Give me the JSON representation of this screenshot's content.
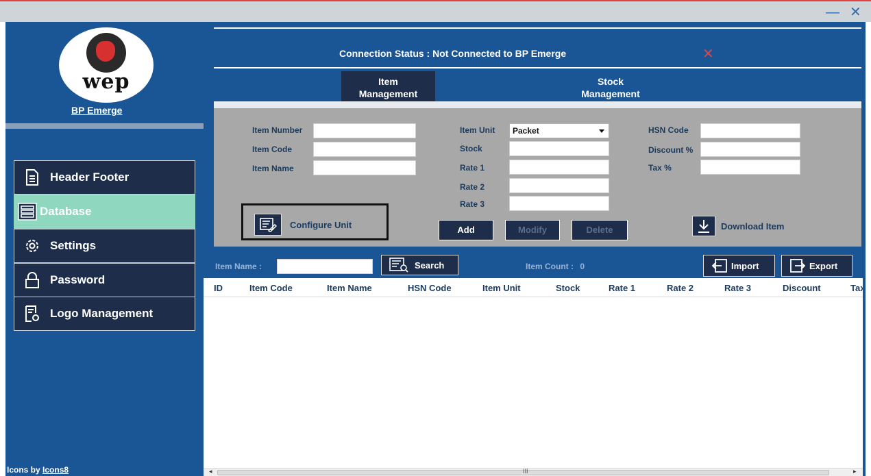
{
  "window": {
    "minimize_glyph": "—",
    "close_glyph": "✕"
  },
  "sidebar": {
    "logo_text": "wep",
    "app_name": "BP Emerge",
    "items": [
      {
        "label": "Header Footer",
        "icon": "document-icon",
        "active": false
      },
      {
        "label": "Database",
        "icon": "database-icon",
        "active": true
      },
      {
        "label": "Settings",
        "icon": "gear-icon",
        "active": false
      },
      {
        "label": "Password",
        "icon": "lock-icon",
        "active": false
      },
      {
        "label": "Logo Management",
        "icon": "logo-settings-icon",
        "active": false
      }
    ],
    "credit_prefix": "Icons by",
    "credit_link": "Icons8"
  },
  "status": {
    "text": "Connection Status :  Not Connected to BP Emerge",
    "indicator": "✕",
    "indicator_color": "#e04545"
  },
  "tabs": [
    {
      "label_line1": "Item",
      "label_line2": "Management",
      "active": true
    },
    {
      "label_line1": "Stock",
      "label_line2": "Management",
      "active": false
    }
  ],
  "form": {
    "item_number_label": "Item Number",
    "item_code_label": "Item Code",
    "item_name_label": "Item Name",
    "item_unit_label": "Item Unit",
    "item_unit_value": "Packet",
    "stock_label": "Stock",
    "rate1_label": "Rate 1",
    "rate2_label": "Rate 2",
    "rate3_label": "Rate 3",
    "hsn_code_label": "HSN Code",
    "discount_label": "Discount %",
    "tax_label": "Tax %",
    "configure_unit_label": "Configure Unit",
    "add_label": "Add",
    "modify_label": "Modify",
    "delete_label": "Delete",
    "download_label": "Download Item"
  },
  "search": {
    "item_name_label": "Item Name :",
    "search_label": "Search",
    "count_label": "Item Count :",
    "count_value": "0",
    "import_label": "Import",
    "export_label": "Export"
  },
  "table": {
    "columns": [
      "ID",
      "Item Code",
      "Item Name",
      "HSN Code",
      "Item Unit",
      "Stock",
      "Rate 1",
      "Rate 2",
      "Rate 3",
      "Discount",
      "Tax"
    ]
  },
  "scrollbar": {
    "left_arrow": "◂",
    "right_arrow": "▸",
    "grip": "III"
  },
  "colors": {
    "sidebar_bg": "#1a5596",
    "nav_bg": "#1e2e4a",
    "nav_active": "#8fd8bf",
    "form_bg": "#a8a8a8"
  }
}
